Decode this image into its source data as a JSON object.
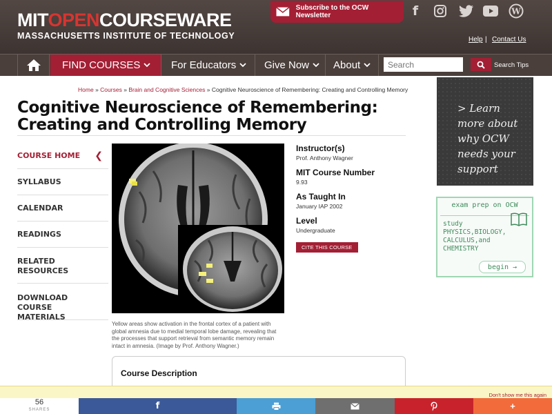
{
  "header": {
    "logo_part1": "MIT",
    "logo_part2": "OPEN",
    "logo_part3": "COURSEWARE",
    "logo_sub": "MASSACHUSETTS INSTITUTE OF TECHNOLOGY",
    "newsletter_label": "Subscribe to the OCW Newsletter",
    "social_icons": [
      "facebook-icon",
      "instagram-icon",
      "twitter-icon",
      "youtube-icon",
      "wordpress-icon"
    ],
    "help_link": "Help",
    "link_separator": "|",
    "contact_link": "Contact Us"
  },
  "nav": {
    "find_courses": "FIND COURSES",
    "for_educators": "For Educators",
    "give_now": "Give Now",
    "about": "About",
    "search_placeholder": "Search",
    "search_tips": "Search Tips"
  },
  "breadcrumb": {
    "home": "Home",
    "courses": "Courses",
    "department": "Brain and Cognitive Sciences",
    "current": "Cognitive Neuroscience of Remembering: Creating and Controlling Memory",
    "separator": "»"
  },
  "page_title": "Cognitive Neuroscience of Remembering: Creating and Controlling Memory",
  "leftnav": {
    "items": [
      {
        "label": "COURSE HOME"
      },
      {
        "label": "SYLLABUS"
      },
      {
        "label": "CALENDAR"
      },
      {
        "label": "READINGS"
      },
      {
        "label": "RELATED RESOURCES"
      },
      {
        "label": "DOWNLOAD COURSE MATERIALS"
      }
    ]
  },
  "image_caption": "Yellow areas show activation in the frontal cortex of a patient with global amnesia due to medial temporal lobe damage, revealing that the processes that support retrieval from semantic memory remain intact in amnesia. (Image by Prof. Anthony Wagner.)",
  "course_info": {
    "instructor_label": "Instructor(s)",
    "instructor_value": "Prof. Anthony Wagner",
    "number_label": "MIT Course Number",
    "number_value": "9.93",
    "taught_label": "As Taught In",
    "taught_value": "January IAP 2002",
    "level_label": "Level",
    "level_value": "Undergraduate",
    "cite_button": "CITE THIS COURSE"
  },
  "description_title": "Course Description",
  "promo_support": {
    "text": "> Learn more about why OCW needs your support"
  },
  "promo_exam": {
    "heading": "exam prep on OCW",
    "body": "study PHYSICS,BIOLOGY, CALCULUS,and CHEMISTRY",
    "begin": "begin →"
  },
  "notice": {
    "dismiss": "Don't show me this again"
  },
  "share": {
    "count": "56",
    "count_label": "SHARES"
  },
  "colors": {
    "brand_red": "#a31f34",
    "header_brown": "#4a3f3b",
    "facebook": "#3b5998",
    "print": "#4b9fd5",
    "email": "#6f6f6f",
    "pinterest": "#c8232c",
    "more": "#f26b3a"
  }
}
